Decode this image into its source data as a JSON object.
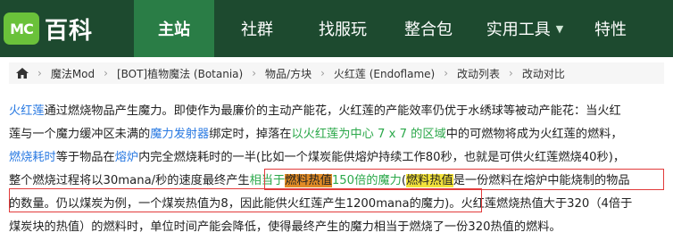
{
  "logo": {
    "badge": "MC",
    "text": "百科"
  },
  "nav": [
    {
      "label": "主站",
      "active": true
    },
    {
      "label": "社群",
      "active": false
    },
    {
      "label": "找服玩",
      "active": false
    },
    {
      "label": "整合包",
      "active": false
    },
    {
      "label": "实用工具",
      "active": false,
      "dropdown": true
    },
    {
      "label": "特性",
      "active": false
    }
  ],
  "breadcrumb": [
    "魔法Mod",
    "[BOT]植物魔法 (Botania)",
    "物品/方块",
    "火红莲 (Endoflame)",
    "改动列表",
    "改动对比"
  ],
  "article": {
    "l1": {
      "a": "火红莲",
      "b": "通过燃烧物品产生魔力。即使作为最廉价的主动产能花，火红莲的产能效率仍优于水绣球等被动产能花：当火红"
    },
    "l2": {
      "a": "莲与一个魔力缓冲区未满的",
      "b": "魔力发射器",
      "c": "绑定时，掉落在",
      "d": "以火红莲为中心 7 x 7 的区域",
      "e": "中的可燃物将成为火红莲的燃料，"
    },
    "l3": {
      "a": "燃烧耗时",
      "b": "等于物品在",
      "c": "熔炉",
      "d": "内完全燃烧耗时的一半(比如一个煤炭能供熔炉持续工作80秒，也就是可供火红莲燃烧40秒)，"
    },
    "l4": {
      "a": "整个燃烧过程将以30mana/秒的速度最终产生",
      "b": "相当于",
      "c": "燃料热值",
      "d": "150倍的魔力",
      "e": "(",
      "f": "燃料热值",
      "g": "是一份燃料在熔炉中能烧制的物品"
    },
    "l5": {
      "a": "的数量。仍以煤炭为例，一个煤炭热值为8，因此能供火红莲产生1200mana的魔力)。",
      "b": "火红莲燃烧热值大于320（4倍于"
    },
    "l6": {
      "a": "煤炭块的热值）的燃料时，单位时间产能会降低，使得最终产生的魔力相当于燃烧了一份320热值的燃料。"
    }
  },
  "colors": {
    "nav_bg": "#1d4a2f",
    "nav_active": "#2a7d46",
    "link": "#2a7ae2",
    "green_text": "#2ba84a",
    "highlight_orange": "#e08b26",
    "highlight_yellow": "#f2e23a",
    "annotation_box": "#e23b3b"
  }
}
